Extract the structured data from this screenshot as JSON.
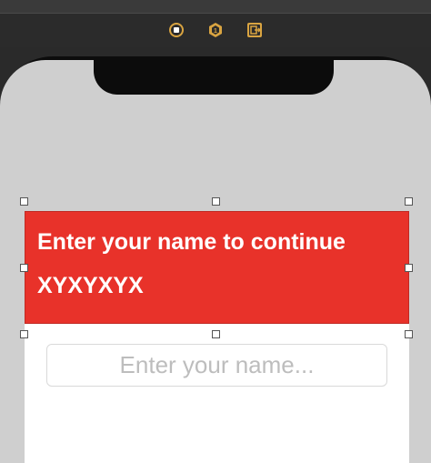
{
  "scene_dock": {
    "icons": [
      "view-controller-icon",
      "first-responder-icon",
      "exit-icon"
    ],
    "accent_color": "#d9a441"
  },
  "header": {
    "title": "Enter your name to continue",
    "subtitle": "XYXYXYX",
    "background_color": "#e8322a"
  },
  "name_field": {
    "value": "",
    "placeholder": "Enter your name..."
  }
}
